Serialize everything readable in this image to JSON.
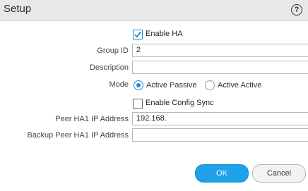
{
  "dialog": {
    "title": "Setup",
    "help_icon_text": "?"
  },
  "form": {
    "enable_ha": {
      "label": "Enable HA",
      "checked": true
    },
    "group_id": {
      "label": "Group ID",
      "value": "2"
    },
    "description": {
      "label": "Description",
      "value": ""
    },
    "mode": {
      "label": "Mode",
      "options": [
        {
          "label": "Active Passive",
          "selected": true
        },
        {
          "label": "Active Active",
          "selected": false
        }
      ]
    },
    "enable_config_sync": {
      "label": "Enable Config Sync",
      "checked": false
    },
    "peer_ha1_ip": {
      "label": "Peer HA1 IP Address",
      "value": "192.168."
    },
    "backup_peer_ha1_ip": {
      "label": "Backup Peer HA1 IP Address",
      "value": ""
    }
  },
  "buttons": {
    "ok": "OK",
    "cancel": "Cancel"
  },
  "colors": {
    "accent": "#1ea1e8",
    "titlebar": "#e8e8e8"
  }
}
